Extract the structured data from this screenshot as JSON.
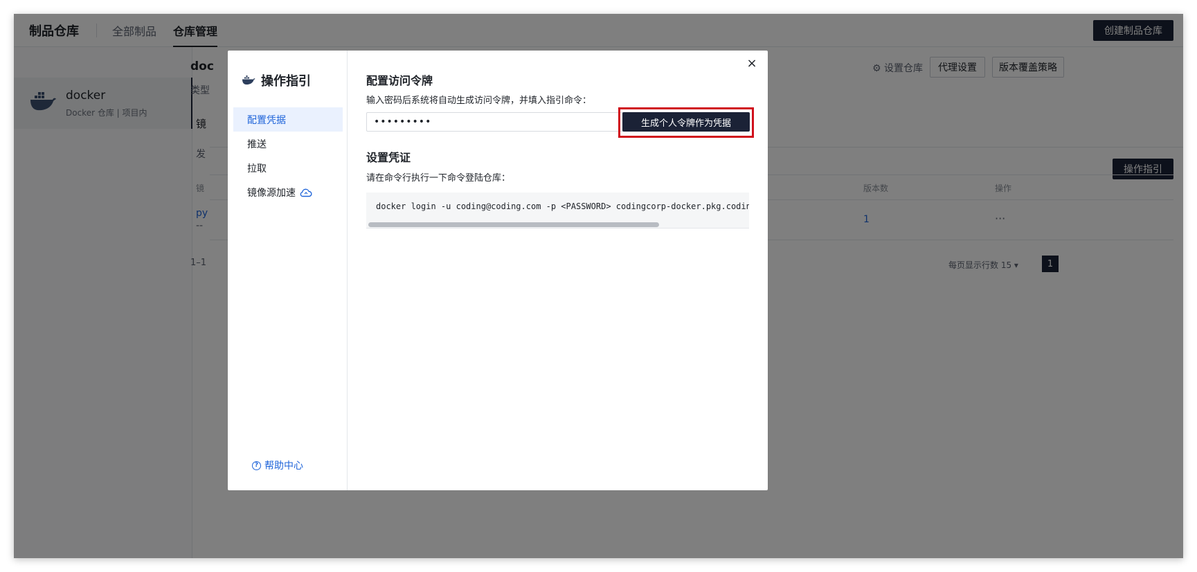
{
  "app": {
    "title": "制品仓库",
    "nav": [
      "全部制品",
      "仓库管理"
    ],
    "create_button": "创建制品仓库"
  },
  "sidebar": {
    "repo_name": "docker",
    "repo_sub": "Docker 仓库 | 项目内"
  },
  "main": {
    "title_frag": "doc",
    "type_frag": "类型",
    "tab_frag": "镜",
    "publish_frag": "发",
    "col_frag": "镜",
    "row_name_frag": "py",
    "row_dash_frag": "--",
    "count_frag": "1–1",
    "settings_link": "设置仓库",
    "proxy_button": "代理设置",
    "override_button": "版本覆盖策略",
    "guide_button": "操作指引",
    "col_versions": "版本数",
    "col_actions": "操作",
    "row_versions": "1",
    "row_more": "···",
    "rows_per_page": "每页显示行数 15",
    "page": "1"
  },
  "modal": {
    "title": "操作指引",
    "nav": [
      {
        "label": "配置凭据",
        "active": true
      },
      {
        "label": "推送",
        "active": false
      },
      {
        "label": "拉取",
        "active": false
      },
      {
        "label": "镜像源加速",
        "active": false
      }
    ],
    "help": "帮助中心",
    "close": "×",
    "section1_title": "配置访问令牌",
    "section1_desc": "输入密码后系统将自动生成访问令牌，并填入指引命令：",
    "password_value": "•••••••••",
    "generate_button": "生成个人令牌作为凭据",
    "section2_title": "设置凭证",
    "section2_desc": "请在命令行执行一下命令登陆仓库：",
    "command": "docker login -u coding@coding.com -p <PASSWORD> codingcorp-docker.pkg.coding.net"
  },
  "colors": {
    "accent": "#1f64d9",
    "dark_button": "#1b2236",
    "highlight_border": "#d0101c"
  }
}
